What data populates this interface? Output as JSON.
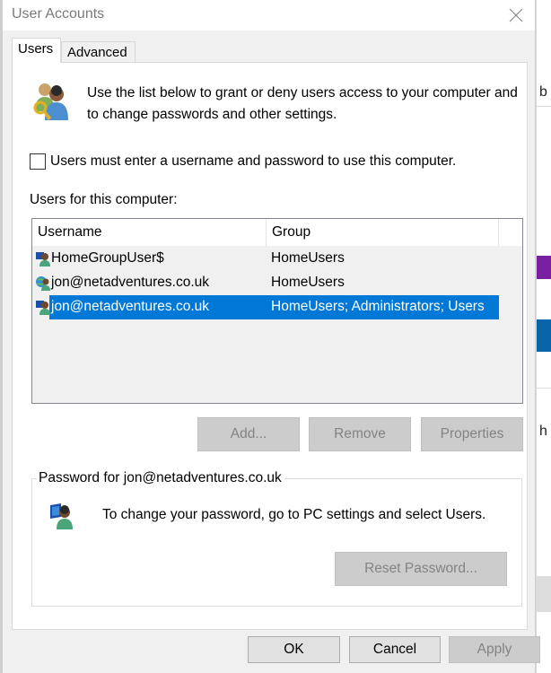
{
  "window": {
    "title": "User Accounts",
    "close_icon": "close-icon"
  },
  "tabs": [
    {
      "label": "Users",
      "active": true
    },
    {
      "label": "Advanced",
      "active": false
    }
  ],
  "intro": {
    "icon": "users-key-icon",
    "text": "Use the list below to grant or deny users access to your computer and to change passwords and other settings."
  },
  "require_login": {
    "label": "Users must enter a username and password to use this computer.",
    "checked": false
  },
  "users_section": {
    "label": "Users for this computer:",
    "columns": [
      "Username",
      "Group"
    ],
    "rows": [
      {
        "username": "HomeGroupUser$",
        "group": "HomeUsers",
        "icon": "local-user-icon",
        "selected": false
      },
      {
        "username": "jon@netadventures.co.uk",
        "group": "HomeUsers",
        "icon": "microsoft-account-user-icon",
        "selected": false
      },
      {
        "username": "jon@netadventures.co.uk",
        "group": "HomeUsers; Administrators; Users",
        "icon": "local-user-icon",
        "selected": true
      }
    ],
    "selection_color": "#0078d7"
  },
  "list_buttons": {
    "add": "Add...",
    "remove": "Remove",
    "properties": "Properties"
  },
  "password_section": {
    "legend": "Password for jon@netadventures.co.uk",
    "icon": "user-computer-icon",
    "text": "To change your password, go to PC settings and select Users.",
    "reset_button": "Reset Password..."
  },
  "footer_buttons": {
    "ok": "OK",
    "cancel": "Cancel",
    "apply": "Apply"
  },
  "background_window": {
    "fragments": [
      "b",
      "h"
    ]
  }
}
